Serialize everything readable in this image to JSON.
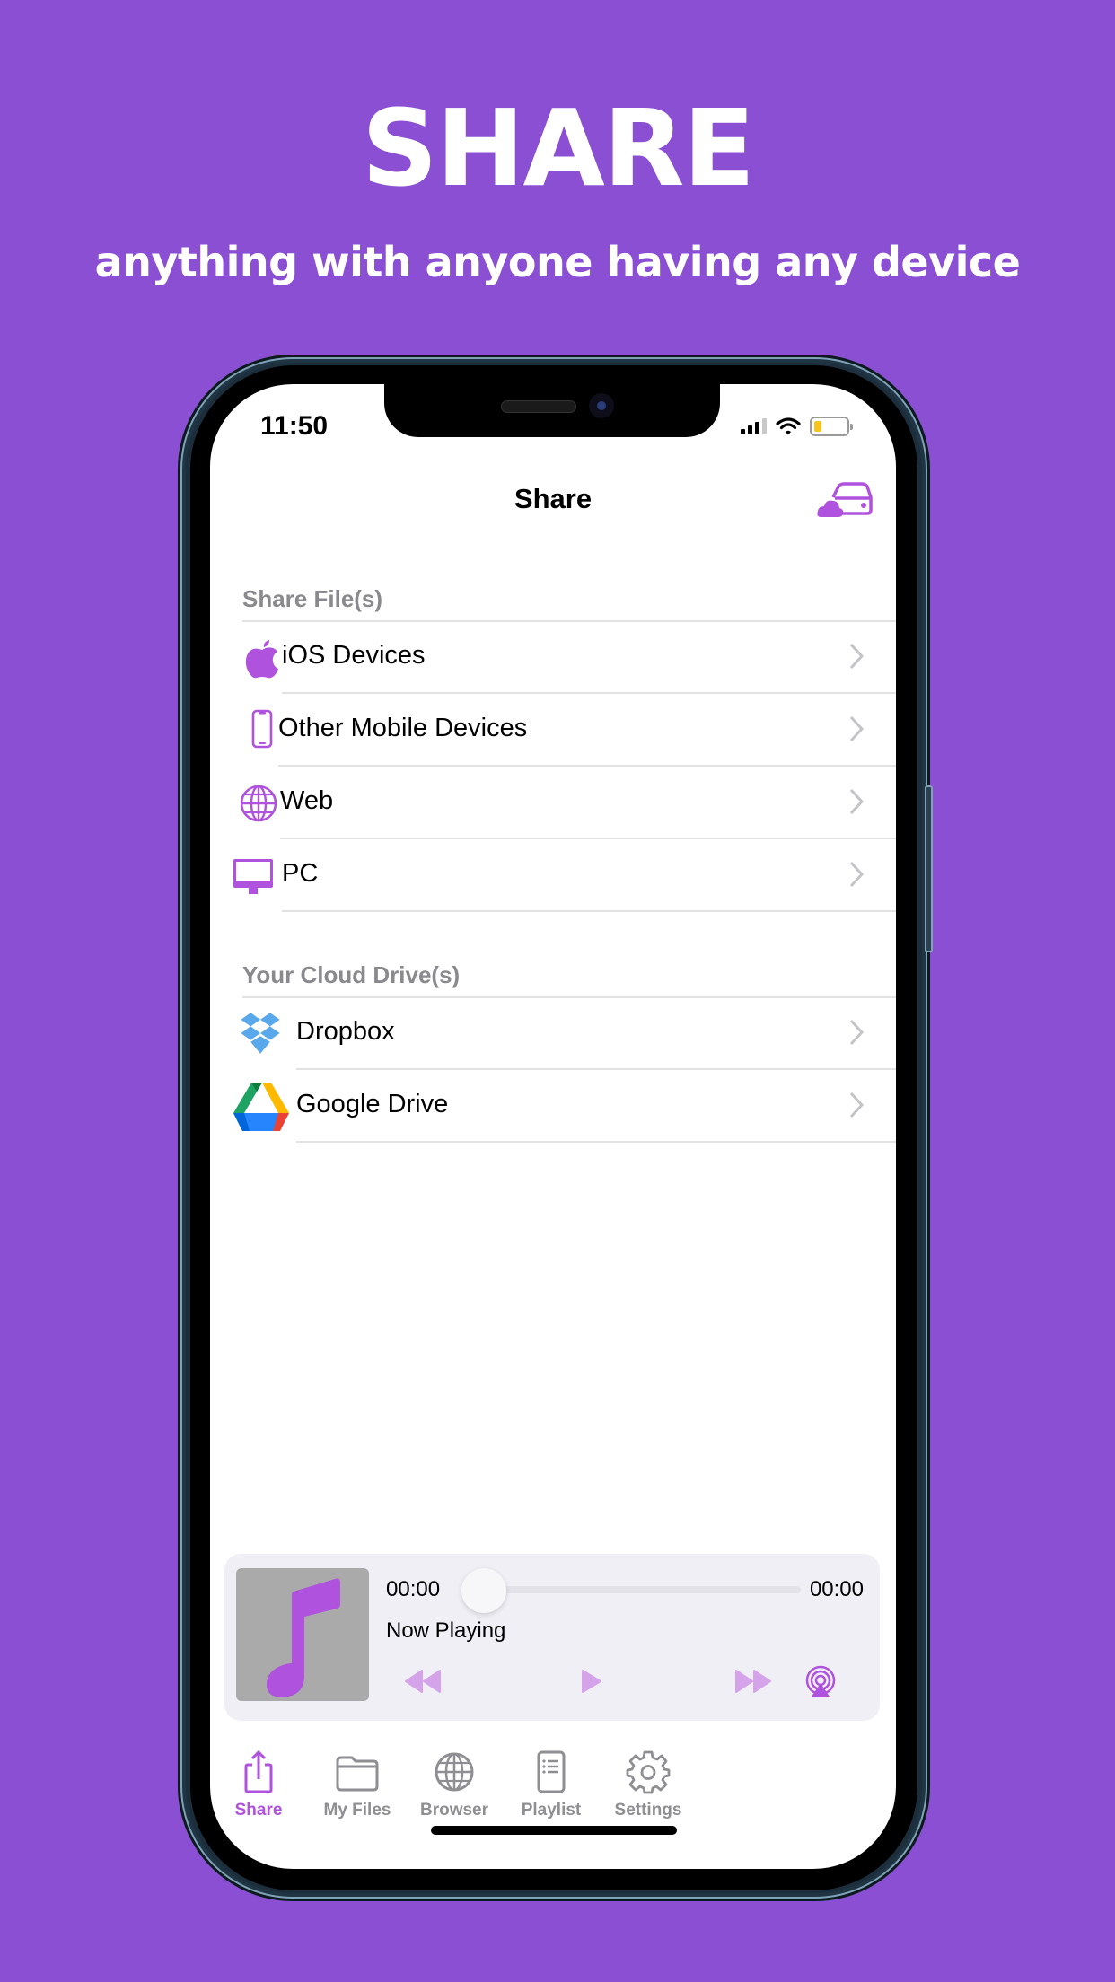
{
  "promo": {
    "headline": "SHARE",
    "subline": "anything with anyone having any device"
  },
  "status_bar": {
    "time": "11:50",
    "signal_icon": "cellular-signal-icon",
    "wifi_icon": "wifi-icon",
    "battery_icon": "battery-low-icon",
    "battery_color": "#f6c41a"
  },
  "nav": {
    "title": "Share",
    "right_action_icon": "cloud-drive-icon"
  },
  "sections": [
    {
      "header": "Share File(s)",
      "items": [
        {
          "label": "iOS Devices",
          "icon": "apple-icon"
        },
        {
          "label": "Other Mobile Devices",
          "icon": "smartphone-icon"
        },
        {
          "label": "Web",
          "icon": "globe-icon"
        },
        {
          "label": "PC",
          "icon": "desktop-monitor-icon"
        }
      ]
    },
    {
      "header": "Your Cloud Drive(s)",
      "items": [
        {
          "label": "Dropbox",
          "icon": "dropbox-icon"
        },
        {
          "label": "Google Drive",
          "icon": "google-drive-icon"
        }
      ]
    }
  ],
  "player": {
    "elapsed": "00:00",
    "duration": "00:00",
    "progress": 0,
    "title": "Now Playing",
    "artwork_icon": "music-note-icon",
    "controls": [
      "rewind-icon",
      "play-icon",
      "fast-forward-icon",
      "airplay-icon"
    ]
  },
  "tabs": [
    {
      "label": "Share",
      "icon": "share-icon",
      "active": true
    },
    {
      "label": "My Files",
      "icon": "folder-icon",
      "active": false
    },
    {
      "label": "Browser",
      "icon": "globe-icon",
      "active": false
    },
    {
      "label": "Playlist",
      "icon": "playlist-icon",
      "active": false
    },
    {
      "label": "Settings",
      "icon": "gear-icon",
      "active": false
    }
  ],
  "colors": {
    "background": "#8a4fd3",
    "accent": "#af52de",
    "accent_light": "#d4a3ea",
    "inactive": "#8e8e93"
  }
}
